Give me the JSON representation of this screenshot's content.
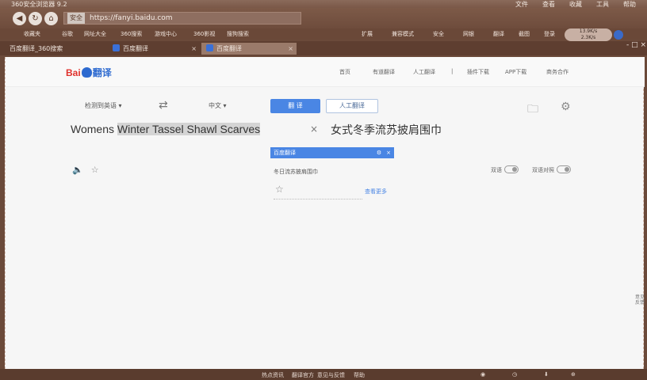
{
  "titlebar": {
    "app": "360安全浏览器 9.2",
    "menus": [
      "文件",
      "查看",
      "收藏",
      "工具",
      "帮助"
    ]
  },
  "navbar": {
    "secure_label": "安全",
    "url": "https://fanyi.baidu.com"
  },
  "bookmarks": [
    "收藏夹",
    "谷歌",
    "网址大全",
    "360搜索",
    "游戏中心",
    "360影视",
    "搜狗搜索"
  ],
  "bookmarks_right": [
    "扩展",
    "兼容模式",
    "安全",
    "网银",
    "翻译",
    "截图",
    "登录"
  ],
  "net_badge": {
    "up": "13.9K/s",
    "down": "2.3K/s"
  },
  "tabs": [
    {
      "label": "百度翻译_360搜索"
    },
    {
      "label": "百度翻译"
    },
    {
      "label": "百度翻译"
    }
  ],
  "window_controls": "- □ ×",
  "header": {
    "logo_bai": "Bai",
    "logo_rest": "翻译",
    "nav": [
      "首页",
      "有道翻译",
      "人工翻译",
      "|",
      "插件下载",
      "APP下载",
      "商务合作"
    ]
  },
  "translator": {
    "source_lang": "检测到英语",
    "target_lang": "中文",
    "swap_icon": "⇄",
    "translate_btn": "翻 译",
    "human_btn": "人工翻译",
    "source_text_plain": "Womens ",
    "source_text_selected": "Winter Tassel Shawl Scarves",
    "clear_icon": "×",
    "target_text": "女式冬季流苏披肩围巾"
  },
  "popup": {
    "title": "百度翻译",
    "settings_icon": "⚙",
    "close_icon": "×"
  },
  "result": {
    "line": "冬日流苏披肩围巾",
    "more": "查看更多",
    "toggle1": "双语",
    "toggle2": "双语对照"
  },
  "side_float": "意见反馈",
  "statusbar": [
    "热点资讯",
    "翻译官方",
    "意见与反馈",
    "帮助"
  ]
}
